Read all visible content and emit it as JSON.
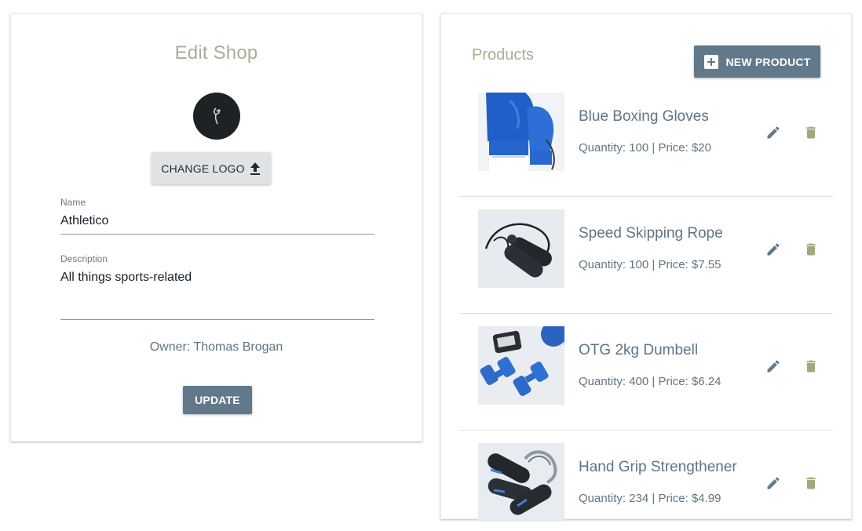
{
  "edit_shop": {
    "title": "Edit Shop",
    "change_logo_label": "CHANGE LOGO",
    "name_label": "Name",
    "name_value": "Athletico",
    "description_label": "Description",
    "description_value": "All things sports-related",
    "owner_text": "Owner: Thomas Brogan",
    "update_label": "UPDATE"
  },
  "products": {
    "title": "Products",
    "new_product_label": "NEW PRODUCT",
    "items": [
      {
        "name": "Blue Boxing Gloves",
        "meta": "Quantity: 100 | Price: $20",
        "image": "boxing-gloves-image"
      },
      {
        "name": "Speed Skipping Rope",
        "meta": "Quantity: 100 | Price: $7.55",
        "image": "skipping-rope-image"
      },
      {
        "name": "OTG 2kg Dumbell",
        "meta": "Quantity: 400 | Price: $6.24",
        "image": "dumbbell-image"
      },
      {
        "name": "Hand Grip Strengthener",
        "meta": "Quantity: 234 | Price: $4.99",
        "image": "hand-grip-image"
      }
    ]
  },
  "colors": {
    "title_accent": "#a3b192",
    "primary_button": "#61798a",
    "edit_icon": "#61798a",
    "delete_icon": "#a3a87a"
  },
  "icons": [
    "upload-icon",
    "plus-icon",
    "edit-icon",
    "delete-icon"
  ]
}
